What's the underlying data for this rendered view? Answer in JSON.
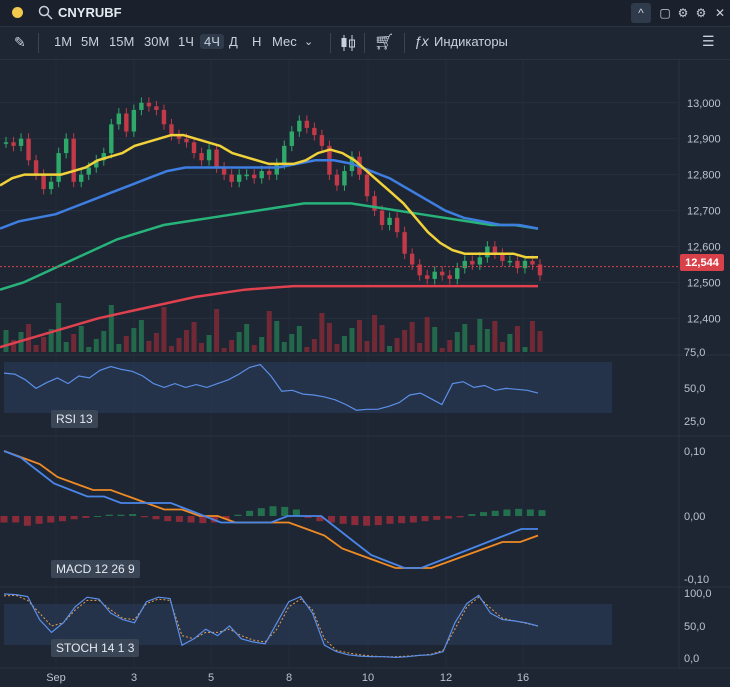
{
  "header": {
    "symbol": "CNYRUBF",
    "status_color": "#f2c94c"
  },
  "toolbar": {
    "timeframes": [
      "1M",
      "5M",
      "15M",
      "30M",
      "1Ч",
      "4Ч",
      "Д",
      "Н",
      "Мес"
    ],
    "active_timeframe": "4Ч",
    "indicators_label": "Индикаторы"
  },
  "price_axis": {
    "ticks": [
      "13,000",
      "12,900",
      "12,800",
      "12,700",
      "12,600",
      "12,500",
      "12,400"
    ],
    "last_price": "12,544",
    "last_price_color": "#d9414a"
  },
  "x_axis": {
    "ticks": [
      "Sep",
      "3",
      "5",
      "8",
      "10",
      "12",
      "16"
    ]
  },
  "indicators": {
    "rsi": {
      "label": "RSI 13",
      "ticks": [
        "75,0",
        "50,0",
        "25,0"
      ]
    },
    "macd": {
      "label": "MACD 12 26 9",
      "ticks": [
        "0,10",
        "0,00",
        "-0,10"
      ]
    },
    "stoch": {
      "label": "STOCH 14 1 3",
      "ticks": [
        "100,0",
        "50,0",
        "0,0"
      ]
    }
  },
  "chart_data": {
    "type": "candlestick",
    "symbol": "CNYRUBF",
    "ylim": [
      12.34,
      13.08
    ],
    "close": [
      12.89,
      12.88,
      12.9,
      12.84,
      12.8,
      12.76,
      12.78,
      12.86,
      12.9,
      12.78,
      12.8,
      12.82,
      12.84,
      12.86,
      12.94,
      12.97,
      12.92,
      12.98,
      13.0,
      12.99,
      12.98,
      12.94,
      12.91,
      12.9,
      12.89,
      12.86,
      12.84,
      12.87,
      12.82,
      12.8,
      12.78,
      12.8,
      12.8,
      12.79,
      12.81,
      12.8,
      12.83,
      12.88,
      12.92,
      12.95,
      12.93,
      12.91,
      12.88,
      12.8,
      12.77,
      12.81,
      12.85,
      12.8,
      12.74,
      12.7,
      12.66,
      12.68,
      12.64,
      12.58,
      12.55,
      12.52,
      12.51,
      12.53,
      12.52,
      12.51,
      12.54,
      12.56,
      12.55,
      12.57,
      12.6,
      12.58,
      12.56,
      12.56,
      12.54,
      12.56,
      12.55,
      12.52
    ],
    "ma_yellow": [
      12.77,
      12.79,
      12.8,
      12.8,
      12.8,
      12.8,
      12.81,
      12.82,
      12.84,
      12.85,
      12.86,
      12.88,
      12.89,
      12.9,
      12.91,
      12.91,
      12.9,
      12.89,
      12.88,
      12.86,
      12.85,
      12.84,
      12.83,
      12.83,
      12.83,
      12.84,
      12.86,
      12.87,
      12.86,
      12.84,
      12.81,
      12.78,
      12.75,
      12.72,
      12.68,
      12.64,
      12.61,
      12.59,
      12.58,
      12.58,
      12.58,
      12.58,
      12.58,
      12.57,
      12.57
    ],
    "ma_blue": [
      12.65,
      12.67,
      12.68,
      12.69,
      12.71,
      12.73,
      12.75,
      12.77,
      12.79,
      12.81,
      12.82,
      12.82,
      12.82,
      12.82,
      12.82,
      12.82,
      12.83,
      12.84,
      12.84,
      12.83,
      12.81,
      12.79,
      12.76,
      12.73,
      12.7,
      12.68,
      12.67,
      12.66,
      12.66,
      12.65
    ],
    "ma_green": [
      12.48,
      12.5,
      12.53,
      12.56,
      12.59,
      12.62,
      12.64,
      12.66,
      12.67,
      12.68,
      12.69,
      12.7,
      12.71,
      12.72,
      12.72,
      12.72,
      12.71,
      12.7,
      12.69,
      12.68,
      12.67,
      12.66,
      12.66,
      12.65
    ],
    "ma_red": [
      12.32,
      12.36,
      12.4,
      12.43,
      12.46,
      12.48,
      12.49,
      12.49,
      12.49,
      12.49,
      12.49,
      12.49
    ],
    "rsi": [
      63,
      62,
      56,
      47,
      53,
      58,
      52,
      60,
      58,
      66,
      70,
      67,
      65,
      60,
      52,
      48,
      52,
      48,
      51,
      48,
      52,
      56,
      62,
      69,
      72,
      60,
      44,
      45,
      41,
      40,
      38,
      35,
      30,
      24,
      25,
      25,
      28,
      32,
      40,
      42,
      36,
      30,
      52,
      54,
      48,
      50,
      45,
      47,
      46,
      45,
      42
    ],
    "macd": [
      0.1,
      0.09,
      0.07,
      0.05,
      0.04,
      0.03,
      0.03,
      0.02,
      0.02,
      0.02,
      0.02,
      0.01,
      0.0,
      -0.01,
      -0.01,
      -0.01,
      -0.01,
      0.0,
      0.0,
      0.0,
      -0.02,
      -0.04,
      -0.06,
      -0.07,
      -0.08,
      -0.08,
      -0.07,
      -0.06,
      -0.05,
      -0.04,
      -0.03,
      -0.02,
      -0.02
    ],
    "macd_signal": [
      0.1,
      0.09,
      0.08,
      0.06,
      0.05,
      0.04,
      0.04,
      0.03,
      0.02,
      0.01,
      0.01,
      0.0,
      0.0,
      -0.01,
      -0.01,
      -0.01,
      -0.01,
      -0.02,
      -0.03,
      -0.05,
      -0.06,
      -0.07,
      -0.08,
      -0.08,
      -0.08,
      -0.07,
      -0.06,
      -0.05,
      -0.04,
      -0.04,
      -0.03
    ],
    "macd_hist": [
      -0.01,
      -0.01,
      -0.015,
      -0.012,
      -0.01,
      -0.008,
      -0.005,
      -0.003,
      0.0,
      0.002,
      0.002,
      0.003,
      -0.002,
      -0.005,
      -0.008,
      -0.009,
      -0.01,
      -0.011,
      -0.01,
      -0.005,
      0.002,
      0.008,
      0.012,
      0.015,
      0.014,
      0.01,
      -0.003,
      -0.008,
      -0.01,
      -0.012,
      -0.014,
      -0.015,
      -0.014,
      -0.012,
      -0.011,
      -0.01,
      -0.008,
      -0.006,
      -0.004,
      -0.002,
      0.003,
      0.006,
      0.008,
      0.01,
      0.011,
      0.01,
      0.009
    ],
    "stoch": [
      100,
      99,
      96,
      60,
      40,
      55,
      80,
      95,
      92,
      70,
      60,
      55,
      88,
      95,
      93,
      20,
      30,
      45,
      35,
      50,
      30,
      25,
      22,
      55,
      88,
      96,
      70,
      20,
      10,
      5,
      3,
      2,
      2,
      1,
      2,
      4,
      5,
      10,
      55,
      85,
      98,
      70,
      60,
      58,
      55,
      50
    ],
    "stoch_signal": [
      97,
      98,
      90,
      70,
      50,
      55,
      75,
      90,
      90,
      75,
      62,
      60,
      85,
      92,
      90,
      35,
      30,
      40,
      40,
      45,
      35,
      28,
      25,
      45,
      80,
      92,
      75,
      30,
      12,
      8,
      5,
      3,
      2,
      2,
      3,
      4,
      6,
      12,
      45,
      80,
      95,
      78,
      62,
      58,
      54,
      50
    ]
  }
}
